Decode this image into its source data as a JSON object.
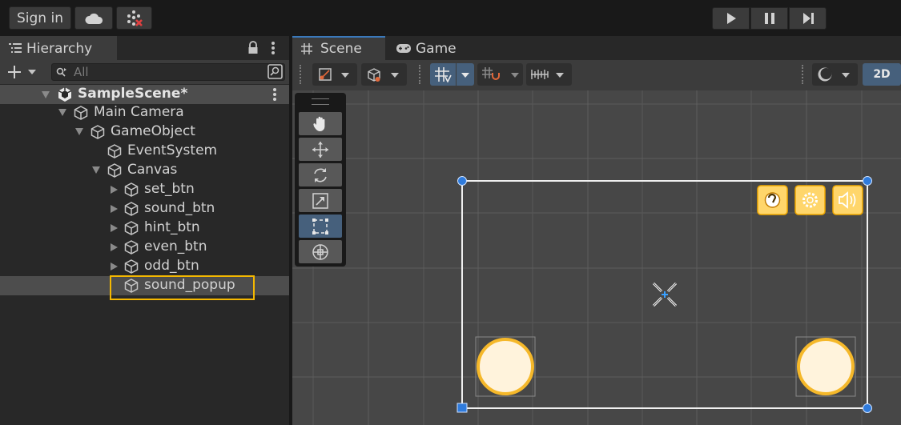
{
  "topbar": {
    "sign_in": "Sign in"
  },
  "hierarchy": {
    "tab_label": "Hierarchy",
    "search_placeholder": "All",
    "scene_name": "SampleScene*",
    "items": [
      {
        "label": "Main Camera",
        "depth": 1,
        "expand": "down"
      },
      {
        "label": "GameObject",
        "depth": 2,
        "expand": "down"
      },
      {
        "label": "EventSystem",
        "depth": 3,
        "expand": "none"
      },
      {
        "label": "Canvas",
        "depth": 3,
        "expand": "down"
      },
      {
        "label": "set_btn",
        "depth": 4,
        "expand": "right"
      },
      {
        "label": "sound_btn",
        "depth": 4,
        "expand": "right"
      },
      {
        "label": "hint_btn",
        "depth": 4,
        "expand": "right"
      },
      {
        "label": "even_btn",
        "depth": 4,
        "expand": "right"
      },
      {
        "label": "odd_btn",
        "depth": 4,
        "expand": "right"
      },
      {
        "label": "sound_popup",
        "depth": 4,
        "expand": "none",
        "selected": true
      }
    ]
  },
  "scene": {
    "tab_scene": "Scene",
    "tab_game": "Game",
    "mode_2d": "2D"
  },
  "colors": {
    "accent_blue": "#3a79bb",
    "highlight_yellow": "#f5b800",
    "button_fill": "#ffd66b",
    "circle_fill": "#fff3dc",
    "circle_stroke": "#f5b82a",
    "handle_blue": "#2f7bdc"
  },
  "icons": [
    "cloud-icon",
    "collab-icon",
    "play-icon",
    "pause-icon",
    "step-icon",
    "hierarchy-list-icon",
    "lock-icon",
    "kebab-menu-icon",
    "add-icon",
    "search-icon",
    "unity-logo-icon",
    "cube-icon",
    "grid-icon",
    "gamepad-icon",
    "hand-tool-icon",
    "move-tool-icon",
    "rotate-tool-icon",
    "scale-tool-icon",
    "rect-tool-icon",
    "transform-tool-icon",
    "camera-gizmo-icon",
    "settings-gear-icon",
    "speaker-icon",
    "hint-icon"
  ]
}
